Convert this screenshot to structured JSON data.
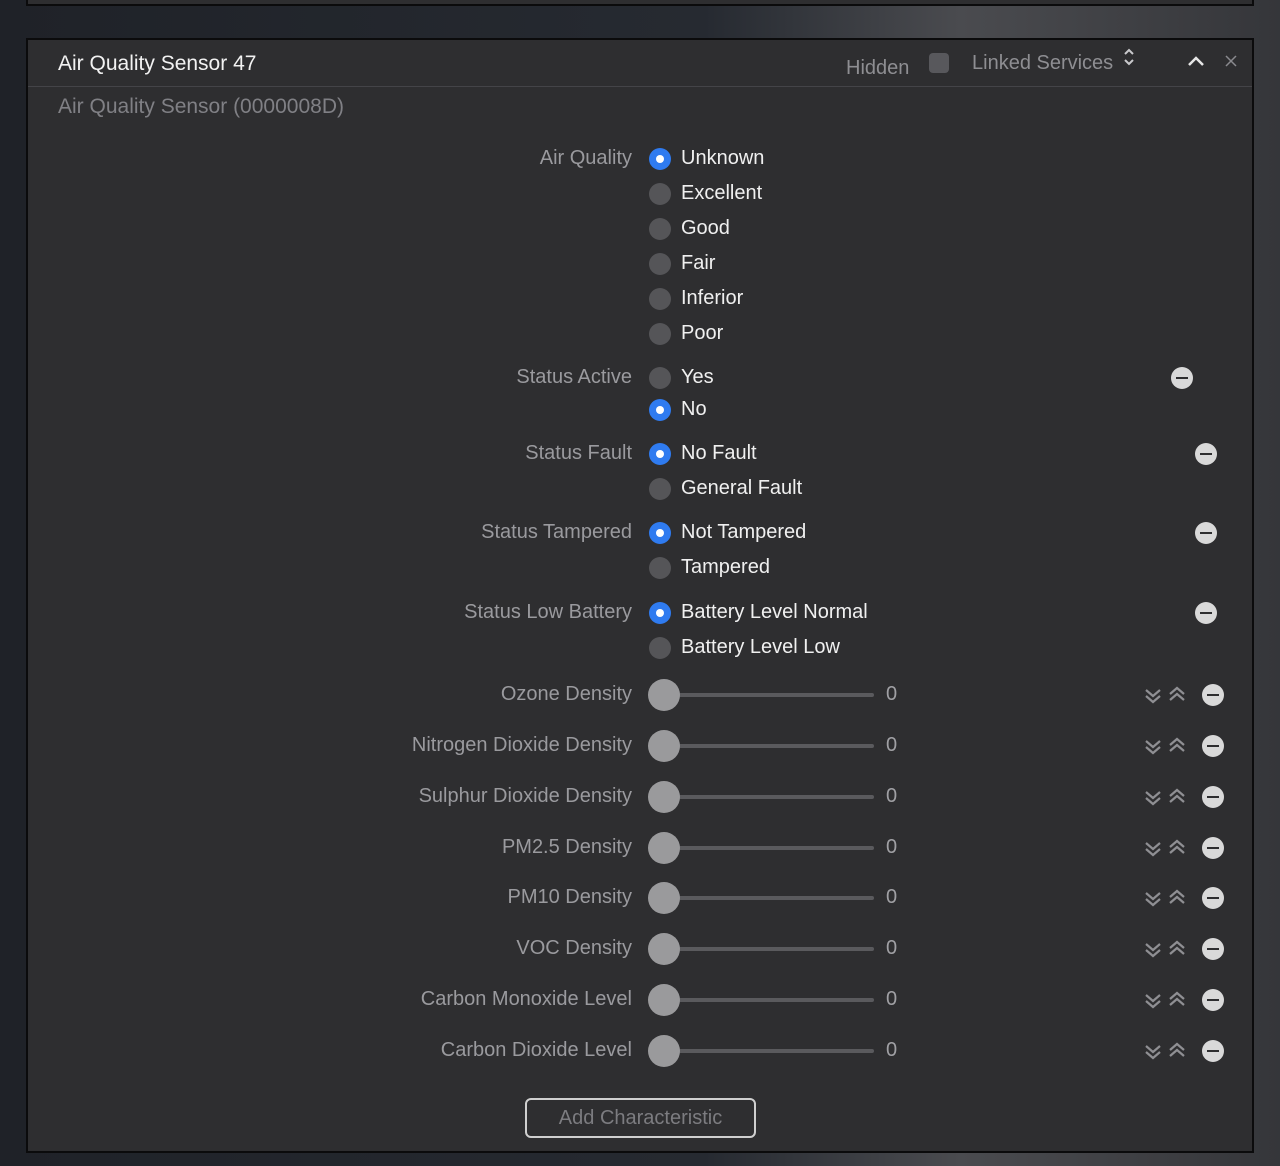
{
  "header": {
    "title": "Air Quality Sensor 47",
    "hidden_label": "Hidden",
    "linked_services_label": "Linked Services",
    "subtitle": "Air Quality Sensor (0000008D)"
  },
  "air_quality": {
    "label": "Air Quality",
    "options": [
      "Unknown",
      "Excellent",
      "Good",
      "Fair",
      "Inferior",
      "Poor"
    ],
    "selected": "Unknown"
  },
  "status_active": {
    "label": "Status Active",
    "options": [
      "Yes",
      "No"
    ],
    "selected": "No"
  },
  "status_fault": {
    "label": "Status Fault",
    "options": [
      "No Fault",
      "General Fault"
    ],
    "selected": "No Fault"
  },
  "status_tampered": {
    "label": "Status Tampered",
    "options": [
      "Not Tampered",
      "Tampered"
    ],
    "selected": "Not Tampered"
  },
  "status_low_battery": {
    "label": "Status Low Battery",
    "options": [
      "Battery Level Normal",
      "Battery Level Low"
    ],
    "selected": "Battery Level Normal"
  },
  "sliders": [
    {
      "label": "Ozone Density",
      "value": "0"
    },
    {
      "label": "Nitrogen Dioxide Density",
      "value": "0"
    },
    {
      "label": "Sulphur Dioxide Density",
      "value": "0"
    },
    {
      "label": "PM2.5 Density",
      "value": "0"
    },
    {
      "label": "PM10 Density",
      "value": "0"
    },
    {
      "label": "VOC Density",
      "value": "0"
    },
    {
      "label": "Carbon Monoxide Level",
      "value": "0"
    },
    {
      "label": "Carbon Dioxide Level",
      "value": "0"
    }
  ],
  "add_button_label": "Add Characteristic",
  "colors": {
    "accent": "#2f7bf0",
    "panel": "#2e2e30"
  }
}
